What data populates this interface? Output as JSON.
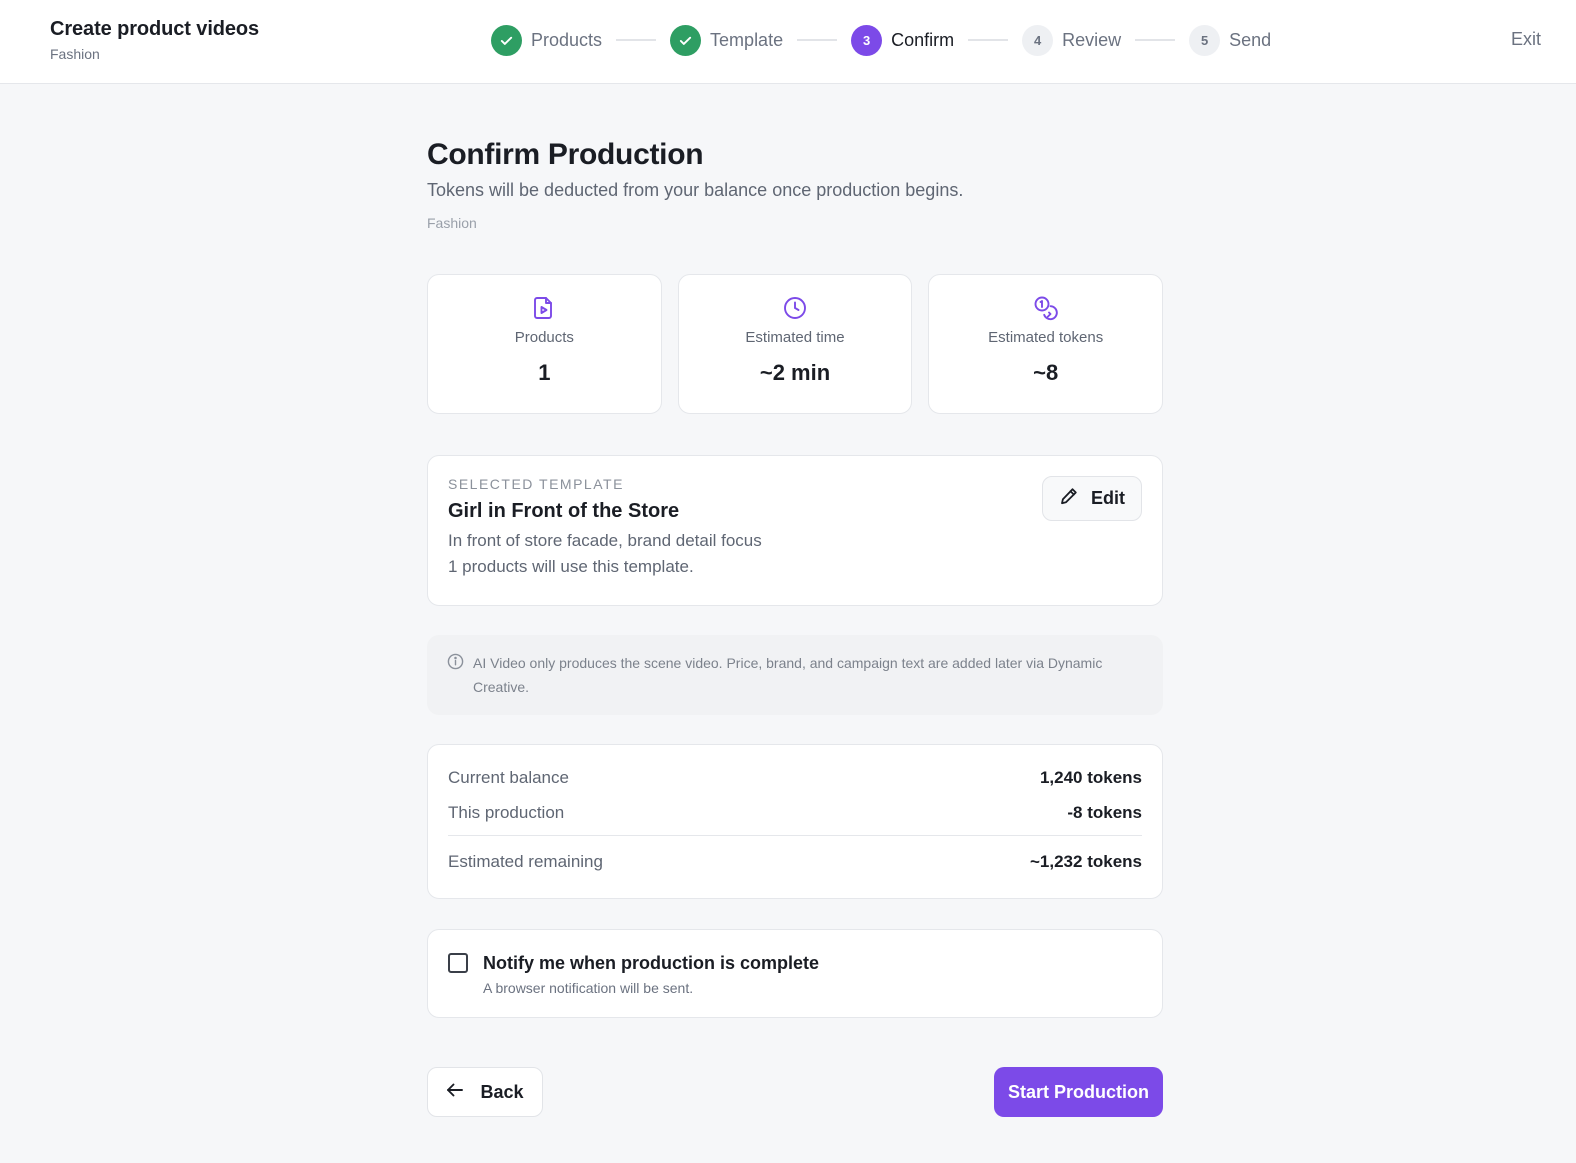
{
  "header": {
    "title": "Create product videos",
    "subtitle": "Fashion",
    "exit_label": "Exit",
    "steps": [
      {
        "number": "1",
        "label": "Products",
        "state": "done"
      },
      {
        "number": "2",
        "label": "Template",
        "state": "done"
      },
      {
        "number": "3",
        "label": "Confirm",
        "state": "current"
      },
      {
        "number": "4",
        "label": "Review",
        "state": "todo"
      },
      {
        "number": "5",
        "label": "Send",
        "state": "todo"
      }
    ]
  },
  "page": {
    "title": "Confirm Production",
    "description": "Tokens will be deducted from your balance once production begins.",
    "category": "Fashion"
  },
  "stats": [
    {
      "icon": "video-file-icon",
      "label": "Products",
      "value": "1"
    },
    {
      "icon": "clock-icon",
      "label": "Estimated time",
      "value": "~2 min"
    },
    {
      "icon": "coins-icon",
      "label": "Estimated tokens",
      "value": "~8"
    }
  ],
  "template": {
    "kicker": "SELECTED TEMPLATE",
    "name": "Girl in Front of the Store",
    "description": "In front of store facade, brand detail focus",
    "usage": "1 products will use this template.",
    "edit_label": "Edit"
  },
  "info": {
    "text": "AI Video only produces the scene video. Price, brand, and campaign text are added later via Dynamic Creative."
  },
  "balance": {
    "current_label": "Current balance",
    "current_value": "1,240 tokens",
    "production_label": "This production",
    "production_value": "-8 tokens",
    "remaining_label": "Estimated remaining",
    "remaining_value": "~1,232 tokens"
  },
  "notify": {
    "title": "Notify me when production is complete",
    "subtitle": "A browser notification will be sent.",
    "checked": false
  },
  "actions": {
    "back_label": "Back",
    "start_label": "Start Production"
  },
  "colors": {
    "accent": "#7c4ae8",
    "success": "#2e9e63",
    "background": "#f6f7f9"
  }
}
